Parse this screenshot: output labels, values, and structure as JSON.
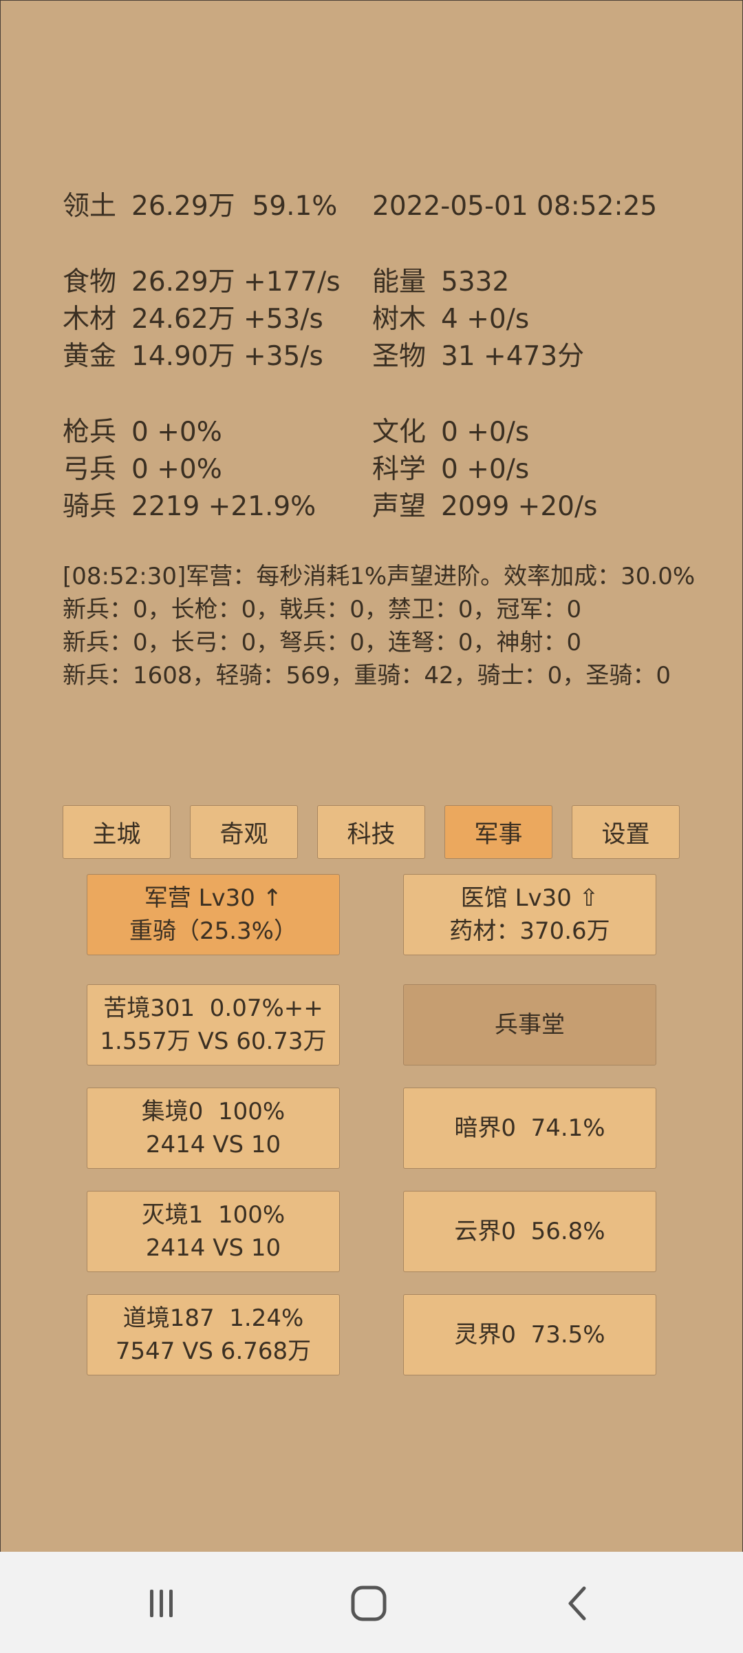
{
  "stats": {
    "territory": {
      "label": "领土",
      "value": "26.29万  59.1%"
    },
    "datetime": "2022-05-01 08:52:25",
    "left_group1": [
      {
        "label": "食物",
        "value": "26.29万 +177/s"
      },
      {
        "label": "木材",
        "value": "24.62万 +53/s"
      },
      {
        "label": "黄金",
        "value": "14.90万 +35/s"
      }
    ],
    "right_group1": [
      {
        "label": "能量",
        "value": "5332"
      },
      {
        "label": "树木",
        "value": "4 +0/s"
      },
      {
        "label": "圣物",
        "value": "31 +473分"
      }
    ],
    "left_group2": [
      {
        "label": "枪兵",
        "value": "0 +0%"
      },
      {
        "label": "弓兵",
        "value": "0 +0%"
      },
      {
        "label": "骑兵",
        "value": "2219 +21.9%"
      }
    ],
    "right_group2": [
      {
        "label": "文化",
        "value": "0 +0/s"
      },
      {
        "label": "科学",
        "value": "0 +0/s"
      },
      {
        "label": "声望",
        "value": "2099 +20/s"
      }
    ]
  },
  "log": [
    "[08:52:30]军营：每秒消耗1%声望进阶。效率加成：30.0%",
    "新兵：0，长枪：0，戟兵：0，禁卫：0，冠军：0",
    "新兵：0，长弓：0，弩兵：0，连弩：0，神射：0",
    "新兵：1608，轻骑：569，重骑：42，骑士：0，圣骑：0"
  ],
  "tabs": [
    "主城",
    "奇观",
    "科技",
    "军事",
    "设置"
  ],
  "active_tab": "军事",
  "cards": {
    "barracks": {
      "line1": "军营 Lv30 ↑",
      "line2": "重骑（25.3%）"
    },
    "clinic": {
      "line1": "医馆 Lv30 ⇧",
      "line2": "药材：370.6万"
    },
    "kujing": {
      "line1": "苦境301  0.07%++",
      "line2": "1.557万 VS 60.73万"
    },
    "bingshitang": {
      "line1": "兵事堂"
    },
    "jijing": {
      "line1": "集境0  100%",
      "line2": "2414 VS 10"
    },
    "anjie": {
      "line1": "暗界0  74.1%"
    },
    "miejing": {
      "line1": "灭境1  100%",
      "line2": "2414 VS 10"
    },
    "yunjie": {
      "line1": "云界0  56.8%"
    },
    "daojing": {
      "line1": "道境187  1.24%",
      "line2": "7547 VS 6.768万"
    },
    "lingjie": {
      "line1": "灵界0  73.5%"
    }
  },
  "colors": {
    "background": "#caa981",
    "button": "#e9bd83",
    "button_active": "#eba85e",
    "button_dark": "#c69e71"
  },
  "navbar_icons": [
    "recent-apps-icon",
    "home-icon",
    "back-icon"
  ]
}
